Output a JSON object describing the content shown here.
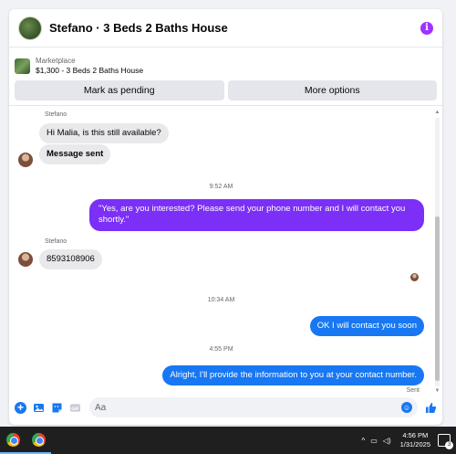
{
  "header": {
    "title": "Stefano · 3 Beds 2 Baths House",
    "info_icon": "info-icon"
  },
  "listing": {
    "source": "Marketplace",
    "title": "$1,300 - 3 Beds 2 Baths House"
  },
  "actions": {
    "mark_pending": "Mark as pending",
    "more_options": "More options"
  },
  "messages": [
    {
      "sender": "Stefano",
      "text": "Hi Malia, is this still available?"
    },
    {
      "text": "Message sent"
    },
    {
      "timestamp": "9:52 AM"
    },
    {
      "text": "\"Yes, are you interested? Please send your phone number and I will contact you shortly.\""
    },
    {
      "sender": "Stefano",
      "text": "8593108906"
    },
    {
      "timestamp": "10:34 AM"
    },
    {
      "text": "OK I will contact you soon"
    },
    {
      "timestamp": "4:55 PM"
    },
    {
      "text": "Alright, I'll provide the information to you at your contact number."
    }
  ],
  "status": "Sent",
  "composer": {
    "placeholder": "Aa"
  },
  "taskbar": {
    "time": "4:56 PM",
    "date": "1/31/2025",
    "notification_count": "3"
  },
  "colors": {
    "accent_blue": "#1877f2",
    "purple_bubble": "#7b2ff7",
    "incoming_bubble": "#e9e9eb"
  }
}
